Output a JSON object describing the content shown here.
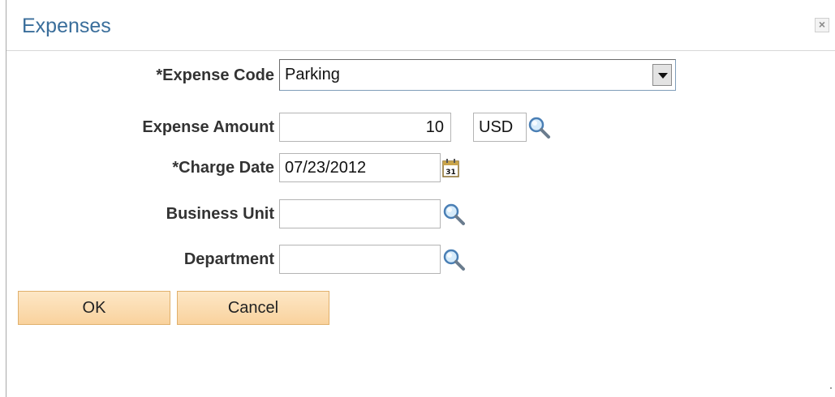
{
  "dialog": {
    "title": "Expenses",
    "close_glyph": "×"
  },
  "form": {
    "expense_code_label": "*Expense Code",
    "expense_code_value": "Parking",
    "expense_amount_label": "Expense Amount",
    "expense_amount_value": "10",
    "currency_value": "USD",
    "charge_date_label": "*Charge Date",
    "charge_date_value": "07/23/2012",
    "calendar_icon_text": "31",
    "business_unit_label": "Business Unit",
    "business_unit_value": "",
    "department_label": "Department",
    "department_value": ""
  },
  "buttons": {
    "ok_label": "OK",
    "cancel_label": "Cancel"
  },
  "icons": {
    "lookup": "magnifier-icon",
    "calendar": "calendar-icon",
    "close": "close-icon",
    "dropdown": "chevron-down-icon"
  }
}
